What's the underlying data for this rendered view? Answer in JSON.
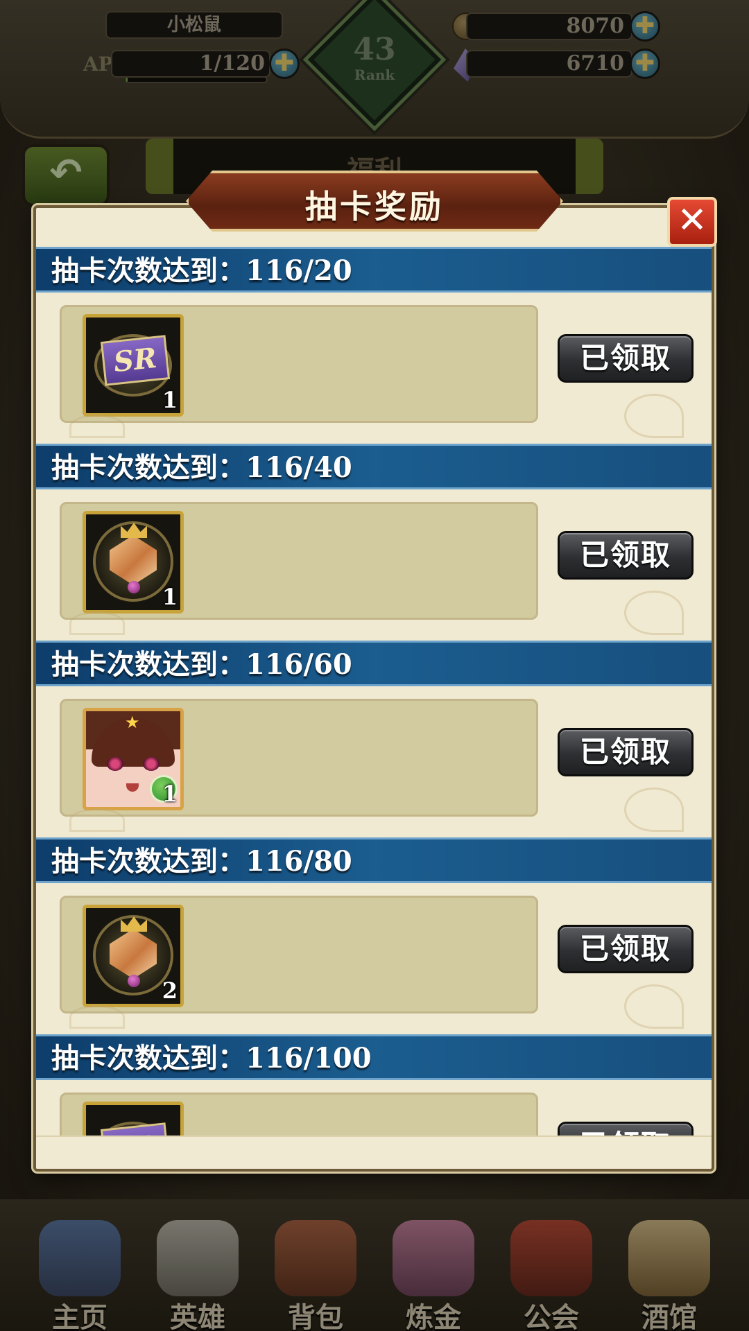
{
  "player": {
    "name": "小松鼠",
    "ap_label": "AP",
    "ap_value": "1/120",
    "ap_fill_fraction": 0.01,
    "rank_number": "43",
    "rank_label": "Rank",
    "gold": "8070",
    "gems": "6710",
    "plus_symbol": "✚"
  },
  "header": {
    "back_icon": "back-arrow-icon",
    "behind_tab_label": "福利"
  },
  "modal": {
    "title": "抽卡奖励",
    "close_label": "✕",
    "entries": [
      {
        "title": "抽卡次数达到：116/20",
        "item": "sr-ticket-icon",
        "count": "1",
        "button": "已领取"
      },
      {
        "title": "抽卡次数达到：116/40",
        "item": "crest-icon",
        "count": "1",
        "button": "已领取"
      },
      {
        "title": "抽卡次数达到：116/60",
        "item": "hero-portrait-icon",
        "count": "1",
        "button": "已领取"
      },
      {
        "title": "抽卡次数达到：116/80",
        "item": "crest-icon",
        "count": "2",
        "button": "已领取"
      },
      {
        "title": "抽卡次数达到：116/100",
        "item": "sr-ticket-icon",
        "count": "",
        "button": "已领取"
      }
    ],
    "sr_text": "SR"
  },
  "nav": {
    "items": [
      {
        "label": "主页",
        "icon": "castle-icon"
      },
      {
        "label": "英雄",
        "icon": "knight-helmet-icon"
      },
      {
        "label": "背包",
        "icon": "backpack-icon"
      },
      {
        "label": "炼金",
        "icon": "potion-icon"
      },
      {
        "label": "公会",
        "icon": "guild-shield-icon"
      },
      {
        "label": "酒馆",
        "icon": "tavern-mug-icon"
      }
    ]
  },
  "colors": {
    "header_blue": "#1b5d8f",
    "title_plate": "#6e2a14",
    "close_red": "#c9301c",
    "panel_cream": "#f1ead2",
    "reward_box": "#d3cba0"
  }
}
